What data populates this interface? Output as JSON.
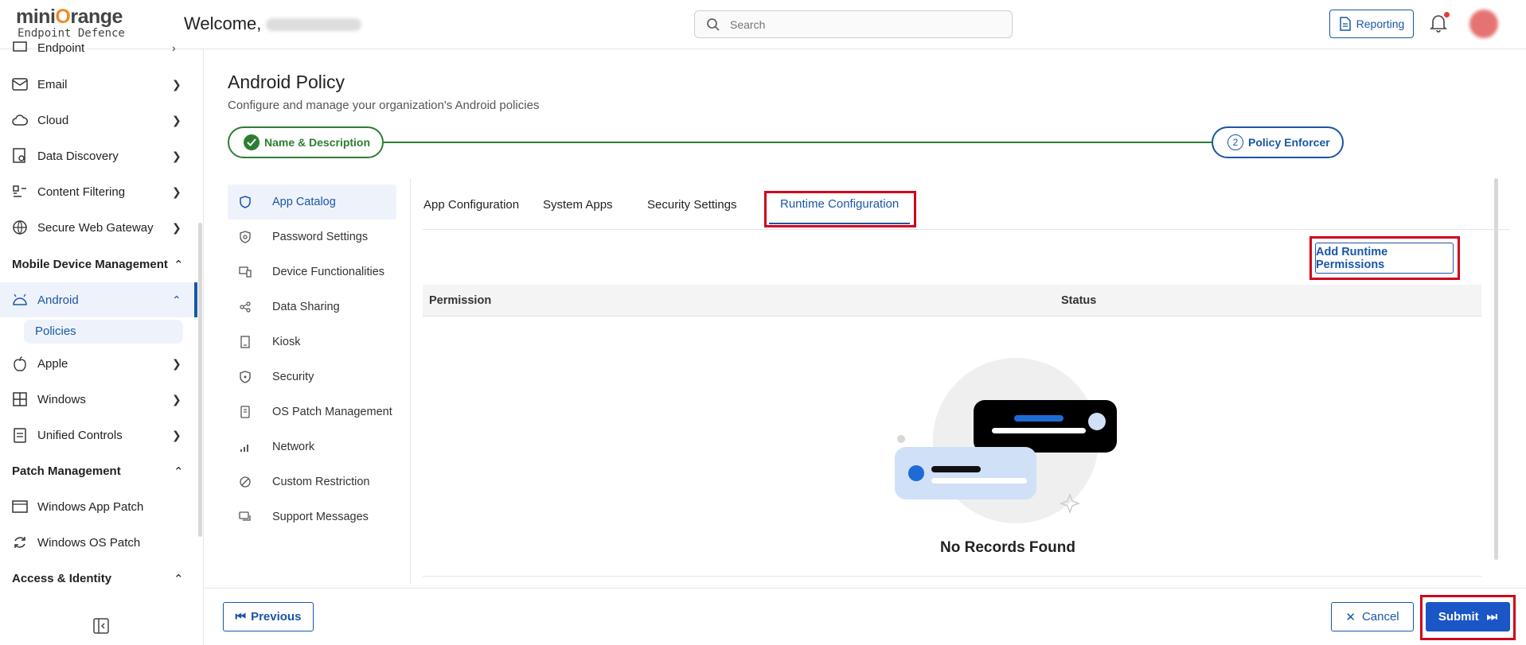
{
  "header": {
    "logo_line1_a": "mini",
    "logo_line1_o": "O",
    "logo_line1_b": "range",
    "logo_line2": "Endpoint Defence",
    "welcome": "Welcome,",
    "search_placeholder": "Search",
    "reporting_label": "Reporting"
  },
  "sidebar": {
    "items": [
      {
        "label": "Endpoint"
      },
      {
        "label": "Email"
      },
      {
        "label": "Cloud"
      },
      {
        "label": "Data Discovery"
      },
      {
        "label": "Content Filtering"
      },
      {
        "label": "Secure Web Gateway"
      }
    ],
    "section_mdm": "Mobile Device Management",
    "android": "Android",
    "policies": "Policies",
    "apple": "Apple",
    "windows": "Windows",
    "unified": "Unified Controls",
    "section_patch": "Patch Management",
    "win_app_patch": "Windows App Patch",
    "win_os_patch": "Windows OS Patch",
    "section_access": "Access & Identity"
  },
  "page": {
    "title": "Android Policy",
    "subtitle": "Configure and manage your organization's Android policies",
    "step1": "Name & Description",
    "step2_num": "2",
    "step2": "Policy Enforcer"
  },
  "leftnav": [
    "App Catalog",
    "Password Settings",
    "Device Functionalities",
    "Data Sharing",
    "Kiosk",
    "Security",
    "OS Patch Management",
    "Network",
    "Custom Restriction",
    "Support Messages"
  ],
  "tabs": [
    "App Configuration",
    "System Apps",
    "Security Settings",
    "Runtime Configuration"
  ],
  "add_button": "Add Runtime Permissions",
  "table": {
    "col_permission": "Permission",
    "col_status": "Status",
    "empty": "No Records Found"
  },
  "footer": {
    "previous": "Previous",
    "cancel": "Cancel",
    "submit": "Submit"
  },
  "colors": {
    "accent": "#1a56a6",
    "success": "#2e7d32",
    "highlight": "#d0021b"
  }
}
